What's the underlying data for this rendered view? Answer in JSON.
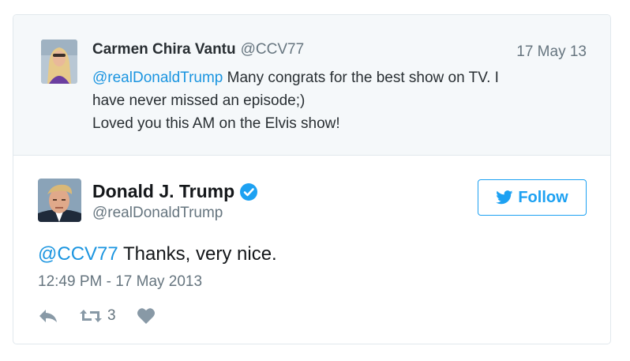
{
  "parent_tweet": {
    "name": "Carmen Chira Vantu",
    "handle": "@CCV77",
    "date": "17 May 13",
    "mention": "@realDonaldTrump",
    "text_line1_rest": " Many congrats for the best show on TV. I",
    "text_line2": "have never missed an episode;)",
    "text_line3": "Loved you this AM on the Elvis show!",
    "avatar_icon": "woman-avatar"
  },
  "main_tweet": {
    "name": "Donald J. Trump",
    "handle": "@realDonaldTrump",
    "verified_icon": "verified-badge-icon",
    "follow_label": "Follow",
    "mention": "@CCV77",
    "text_rest": " Thanks, very nice.",
    "timestamp": "12:49 PM - 17 May 2013",
    "retweet_count": "3",
    "avatar_icon": "man-avatar"
  },
  "colors": {
    "accent": "#1da1f2",
    "mention": "#1b95e0",
    "secondary_text": "#66757f",
    "parent_bg": "#f5f8fa",
    "border": "#e1e8ed"
  }
}
